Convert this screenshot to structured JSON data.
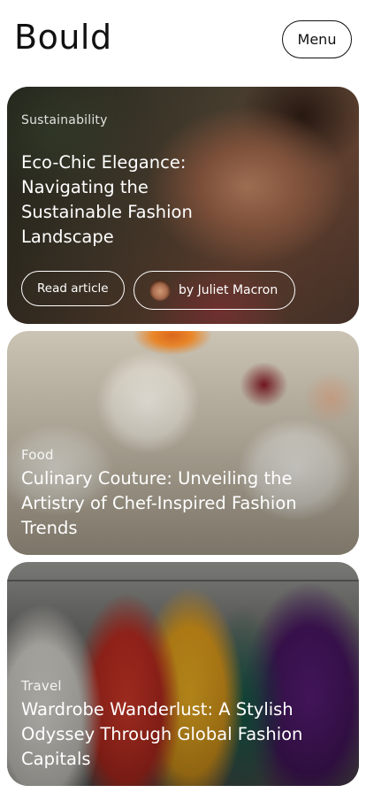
{
  "header": {
    "brand": "Bould",
    "menu_label": "Menu"
  },
  "articles": [
    {
      "category": "Sustainability",
      "title": "Eco-Chic Elegance: Navigating the Sustainable Fashion Landscape",
      "read_label": "Read article",
      "author_label": "by Juliet Macron"
    },
    {
      "category": "Food",
      "title": "Culinary Couture: Unveiling the Artistry of Chef-Inspired Fashion Trends"
    },
    {
      "category": "Travel",
      "title": "Wardrobe Wanderlust: A Stylish Odyssey Through Global Fashion Capitals"
    }
  ],
  "colors": {
    "background": "#ffffff",
    "text": "#111111",
    "overlay_text": "#ffffff"
  },
  "icons": {
    "author_avatar": "avatar-photo"
  }
}
